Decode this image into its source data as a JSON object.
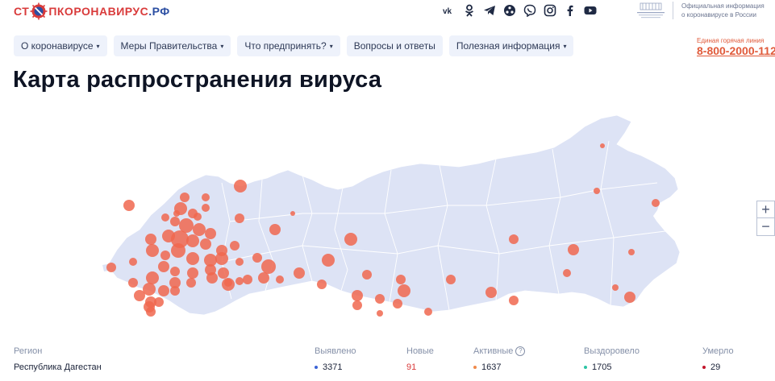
{
  "header": {
    "logo": {
      "prefix": "СТ",
      "suffix": "ПКОРОНАВИРУС",
      "domain": ".РФ"
    },
    "socials": [
      "vk-icon",
      "odnoklassniki-icon",
      "telegram-icon",
      "share-icon",
      "viber-icon",
      "instagram-icon",
      "facebook-icon",
      "youtube-icon"
    ],
    "gov_text_line1": "Официальная информация",
    "gov_text_line2": "о коронавирусе в России"
  },
  "nav": {
    "items": [
      {
        "label": "О коронавирусе",
        "has_caret": true
      },
      {
        "label": "Меры Правительства",
        "has_caret": true
      },
      {
        "label": "Что предпринять?",
        "has_caret": true
      },
      {
        "label": "Вопросы и ответы",
        "has_caret": false
      },
      {
        "label": "Полезная информация",
        "has_caret": true
      }
    ],
    "caret": "▾"
  },
  "hotline": {
    "label": "Единая горячая линия",
    "phone": "8-800-2000-112"
  },
  "page": {
    "title": "Карта распространения вируса"
  },
  "map": {
    "land_color": "#dde3f5",
    "marker_color": "#f0674f"
  },
  "zoom": {
    "in": "+",
    "out": "−"
  },
  "table": {
    "headers": {
      "region": "Регион",
      "found": "Выявлено",
      "new": "Новые",
      "active": "Активные",
      "recovered": "Выздоровело",
      "died": "Умерло"
    },
    "help": "?",
    "row": {
      "region": "Республика Дагестан",
      "found": "3371",
      "new": "91",
      "active": "1637",
      "recovered": "1705",
      "died": "29"
    },
    "colors": {
      "found": "#3b63d6",
      "new": "#e0343a",
      "active": "#f08a4b",
      "recovered": "#2cc4a4",
      "died": "#c2152b"
    }
  }
}
